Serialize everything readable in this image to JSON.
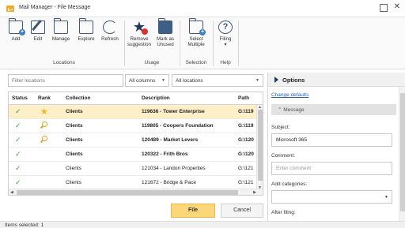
{
  "window": {
    "title": "Mail Manager - File Message"
  },
  "ribbon": {
    "locations": {
      "label": "Locations",
      "add": "Add",
      "edit": "Edit",
      "manage": "Manage",
      "explore": "Explore",
      "refresh": "Refresh"
    },
    "usage": {
      "label": "Usage",
      "remove_line1": "Remove",
      "remove_line2": "suggestion",
      "mark_line1": "Mark as",
      "mark_line2": "Unused"
    },
    "selection": {
      "label": "Selection",
      "select_line1": "Select",
      "select_line2": "Multiple"
    },
    "help": {
      "label": "Help",
      "filing_line1": "Filing",
      "filing_line2": "▾"
    }
  },
  "filter": {
    "placeholder": "Filter locations",
    "columns_select": "All columns",
    "locations_select": "All locations"
  },
  "table": {
    "headers": {
      "status": "Status",
      "rank": "Rank",
      "collection": "Collection",
      "description": "Description",
      "path": "Path"
    },
    "rows": [
      {
        "status": "✓",
        "rank": "star",
        "collection": "Clients",
        "description": "119636 - Tower Enterprise",
        "path": "G:\\119",
        "bold": true,
        "selected": true
      },
      {
        "status": "✓",
        "rank": "search",
        "collection": "Clients",
        "description": "119805 - Coopers Foundation",
        "path": "G:\\119",
        "bold": true,
        "selected": false
      },
      {
        "status": "✓",
        "rank": "search",
        "collection": "Clients",
        "description": "120489 - Market Levers",
        "path": "G:\\120",
        "bold": true,
        "selected": false
      },
      {
        "status": "✓",
        "rank": "",
        "collection": "Clients",
        "description": "120322 - Frith Bros",
        "path": "G:\\120",
        "bold": true,
        "selected": false
      },
      {
        "status": "✓",
        "rank": "",
        "collection": "Clients",
        "description": "121034 - Landon Properties",
        "path": "G:\\121",
        "bold": false,
        "selected": false
      },
      {
        "status": "✓",
        "rank": "",
        "collection": "Clients",
        "description": "121672 - Bridge & Pace",
        "path": "G:\\121",
        "bold": false,
        "selected": false
      }
    ]
  },
  "buttons": {
    "file": "File",
    "cancel": "Cancel"
  },
  "status_bar": {
    "text": "Items selected: 1"
  },
  "options": {
    "title": "Options",
    "change_defaults": "Change defaults",
    "section": "Message",
    "subject_label": "Subject:",
    "subject_value": "Microsoft 365",
    "comment_label": "Comment:",
    "comment_placeholder": "Enter comment",
    "categories_label": "Add categories:",
    "after_filing_label": "After filing:"
  },
  "colors": {
    "selected_row": "#fdefc8",
    "file_button": "#fbd77a",
    "check": "#44a34c",
    "rank_star": "#f2b51b",
    "link": "#2a64b0",
    "icon": "#41577a"
  }
}
